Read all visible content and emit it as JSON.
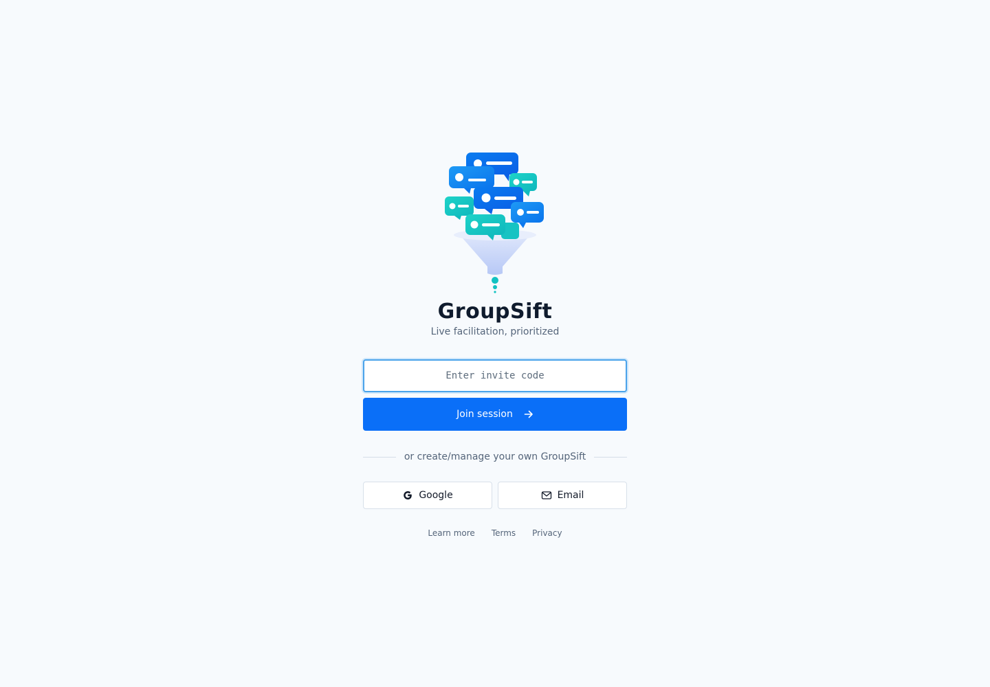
{
  "app": {
    "title": "GroupSift",
    "subtitle": "Live facilitation, prioritized"
  },
  "join": {
    "placeholder": "Enter invite code",
    "value": "",
    "button_label": "Join session",
    "button_icon": "arrow-right-icon"
  },
  "divider": {
    "text": "or create/manage your own GroupSift"
  },
  "auth": {
    "google_label": "Google",
    "google_icon": "google-icon",
    "email_label": "Email",
    "email_icon": "mail-icon"
  },
  "footer": {
    "links": [
      "Learn more",
      "Terms",
      "Privacy"
    ]
  },
  "colors": {
    "primary": "#0a6ff8",
    "background": "#f7fafd",
    "teal": "#12c2c2",
    "focus_ring": "#4aa3ea"
  }
}
